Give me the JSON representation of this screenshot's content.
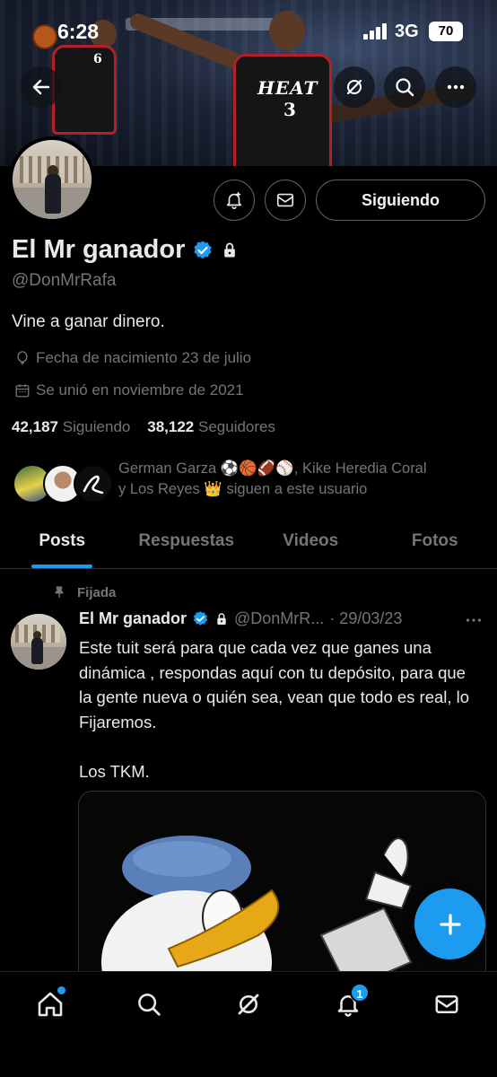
{
  "status_bar": {
    "time": "6:28",
    "network": "3G",
    "battery": "70"
  },
  "banner": {
    "jersey_main": "HEAT",
    "jersey_main_number": "3",
    "jersey_left_number": "6"
  },
  "profile": {
    "name": "El Mr ganador",
    "handle": "@DonMrRafa",
    "bio": "Vine a ganar dinero.",
    "birth": "Fecha de nacimiento 23 de julio",
    "joined": "Se unió en noviembre de 2021",
    "following_count": "42,187",
    "following_label": "Siguiendo",
    "followers_count": "38,122",
    "followers_label": "Seguidores",
    "follow_button": "Siguiendo",
    "followed_by_line1": "German Garza ⚽🏀🏈⚾, Kike Heredia Coral",
    "followed_by_line2": "y Los Reyes 👑  siguen a este usuario"
  },
  "tabs": [
    {
      "label": "Posts",
      "active": true
    },
    {
      "label": "Respuestas",
      "active": false
    },
    {
      "label": "Videos",
      "active": false
    },
    {
      "label": "Fotos",
      "active": false
    }
  ],
  "post": {
    "pinned_label": "Fijada",
    "name": "El Mr ganador",
    "handle": "@DonMrR...",
    "date": "· 29/03/23",
    "paragraph1": "Este tuit será para que cada vez que ganes una dinámica , respondas aquí con tu depósito, para que la gente nueva o quién sea, vean que todo es real, lo Fijaremos.",
    "paragraph2": "Los TKM."
  },
  "bottom_nav": {
    "items": [
      "home-icon",
      "search-icon",
      "grok-icon",
      "notifications-icon",
      "messages-icon"
    ],
    "notifications_badge": "1"
  },
  "colors": {
    "accent": "#1d9bf0",
    "muted": "#71767b",
    "text": "#e7e9ea",
    "border": "#2f3336"
  }
}
